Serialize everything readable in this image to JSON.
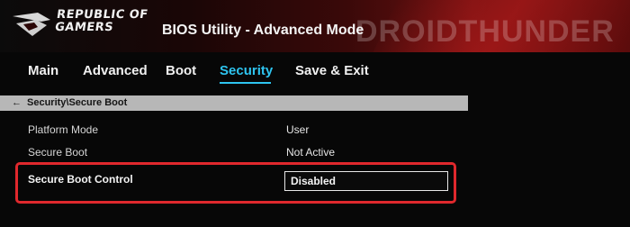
{
  "header": {
    "brand_line1": "REPUBLIC OF",
    "brand_line2": "GAMERS",
    "title": "BIOS Utility - Advanced Mode",
    "watermark": "DROIDTHUNDER",
    "accent_color": "#c81e1e"
  },
  "nav": {
    "items": [
      {
        "label": "Main"
      },
      {
        "label": "Advanced"
      },
      {
        "label": "Boot"
      },
      {
        "label": "Security",
        "active": true
      },
      {
        "label": "Save & Exit"
      }
    ],
    "active_color": "#2ec4ef"
  },
  "breadcrumb": {
    "back_icon": "back-arrow-icon",
    "back_glyph": "←",
    "path": "Security\\Secure Boot"
  },
  "settings": [
    {
      "label": "Platform Mode",
      "value": "User"
    },
    {
      "label": "Secure Boot",
      "value": "Not Active"
    },
    {
      "label": "Secure Boot Control",
      "value": "Disabled"
    }
  ],
  "highlight_color": "#e0282d"
}
